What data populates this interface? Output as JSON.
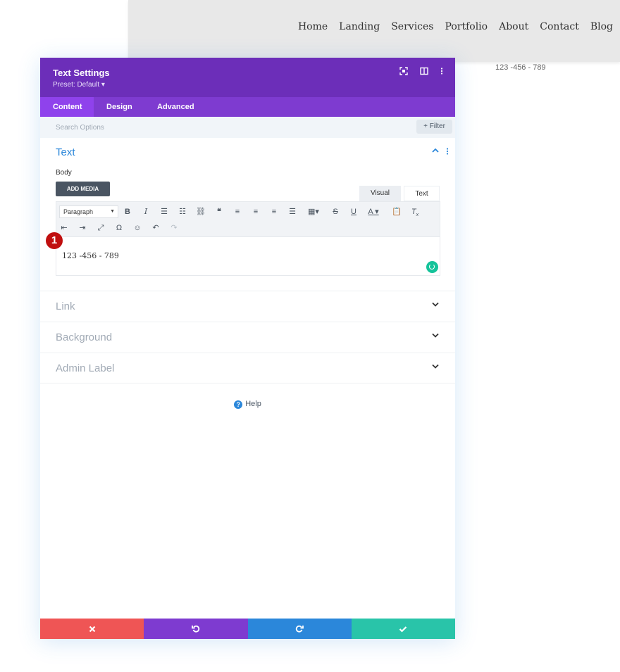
{
  "site": {
    "nav": [
      "Home",
      "Landing",
      "Services",
      "Portfolio",
      "About",
      "Contact",
      "Blog"
    ],
    "phone": "123 -456 - 789"
  },
  "modal": {
    "title": "Text Settings",
    "preset": "Preset: Default ▾",
    "header_icons": [
      "expand-icon",
      "sidebar-icon",
      "more-icon"
    ],
    "tabs": [
      "Content",
      "Design",
      "Advanced"
    ],
    "active_tab": "Content",
    "search_placeholder": "Search Options",
    "filter_label": "+ Filter",
    "text_section": {
      "title": "Text",
      "body_label": "Body",
      "add_media": "ADD MEDIA",
      "editor_tabs": [
        "Visual",
        "Text"
      ],
      "format_select": "Paragraph",
      "content": "123 -456 - 789",
      "step_badge": "1"
    },
    "sections": [
      "Link",
      "Background",
      "Admin Label"
    ],
    "help": "Help",
    "footer_colors": {
      "cancel": "#ef5555",
      "undo": "#7e3bd0",
      "redo": "#2b87da",
      "save": "#29c4a9"
    }
  }
}
